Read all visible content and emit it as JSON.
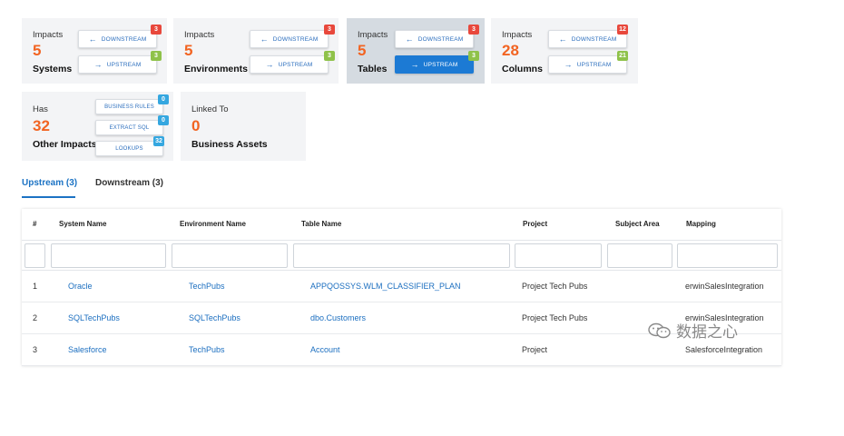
{
  "cards": [
    {
      "caption": "Impacts",
      "count": "5",
      "label": "Systems",
      "downstream": "DOWNSTREAM",
      "upstream": "UPSTREAM",
      "downstream_count": "3",
      "upstream_count": "3"
    },
    {
      "caption": "Impacts",
      "count": "5",
      "label": "Environments",
      "downstream": "DOWNSTREAM",
      "upstream": "UPSTREAM",
      "downstream_count": "3",
      "upstream_count": "3"
    },
    {
      "caption": "Impacts",
      "count": "5",
      "label": "Tables",
      "downstream": "DOWNSTREAM",
      "upstream": "UPSTREAM",
      "downstream_count": "3",
      "upstream_count": "3"
    },
    {
      "caption": "Impacts",
      "count": "28",
      "label": "Columns",
      "downstream": "DOWNSTREAM",
      "upstream": "UPSTREAM",
      "downstream_count": "12",
      "upstream_count": "21"
    }
  ],
  "other": {
    "caption": "Has",
    "count": "32",
    "label": "Other Impacts",
    "buttons": [
      {
        "label": "BUSINESS RULES",
        "count": "0"
      },
      {
        "label": "EXTRACT SQL",
        "count": "0"
      },
      {
        "label": "LOOKUPS",
        "count": "32"
      }
    ]
  },
  "linked": {
    "caption": "Linked To",
    "count": "0",
    "label": "Business Assets"
  },
  "tabs": [
    {
      "label": "Upstream (3)"
    },
    {
      "label": "Downstream (3)"
    }
  ],
  "table": {
    "headers": [
      "#",
      "System Name",
      "Environment Name",
      "Table Name",
      "Project",
      "Subject Area",
      "Mapping"
    ],
    "rows": [
      [
        "1",
        "Oracle",
        "TechPubs",
        "APPQOSSYS.WLM_CLASSIFIER_PLAN",
        "Project Tech Pubs",
        "",
        "erwinSalesIntegration"
      ],
      [
        "2",
        "SQLTechPubs",
        "SQLTechPubs",
        "dbo.Customers",
        "Project Tech Pubs",
        "",
        "erwinSalesIntegration"
      ],
      [
        "3",
        "Salesforce",
        "TechPubs",
        "Account",
        "Project",
        "",
        "SalesforceIntegration"
      ]
    ]
  },
  "watermark": {
    "text": "数据之心"
  },
  "colors": {
    "accent": "#1c7ad4",
    "count": "#f26422",
    "link": "#1c6fc0",
    "badge_red": "#e8483c",
    "badge_green": "#8fc24a",
    "badge_blue": "#35a7e0"
  }
}
